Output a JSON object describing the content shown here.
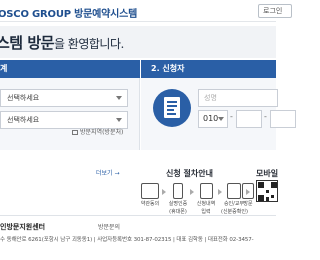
{
  "header": {
    "brand": "OSCO GROUP 방문예약시스템",
    "login_label": "로그인"
  },
  "welcome": {
    "main": "스템 방문",
    "suffix": "을 환영합니다."
  },
  "steps": {
    "step1_title": "계",
    "step2_title": "2. 신청자"
  },
  "form1": {
    "select1": "선택하세요",
    "select2": "선택하세요",
    "lookup_label": "방문지역(방문처)"
  },
  "form2": {
    "name_placeholder": "성명",
    "phone_prefix": "010",
    "phone_dash": "-"
  },
  "procedure": {
    "more_label": "더보기 →",
    "title": "신청 절차안내",
    "mobile_title": "모바일",
    "items": [
      {
        "label": "약관동의"
      },
      {
        "label": "실명인증",
        "sub": "(휴대폰)"
      },
      {
        "label": "신청내역",
        "sub": "입력"
      },
      {
        "label": "승인/교부",
        "sub": "(신분증확인)"
      },
      {
        "label": "방문"
      }
    ]
  },
  "footer": {
    "org": "인방문지원센터",
    "link": "방문문의",
    "address": "수 동해안로 6261(포항시 남구 괴동동1) | 사업자등록번호 301-87-02315 | 대표 김학동 | 대표전화 02-3457-"
  },
  "colors": {
    "brand": "#1f4f8f",
    "step_bar": "#2a5fa6"
  }
}
